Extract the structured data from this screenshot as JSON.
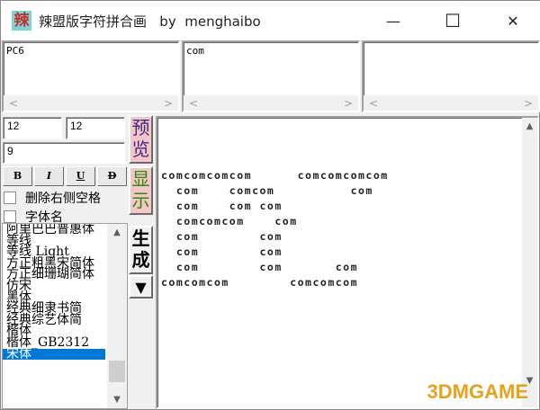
{
  "window": {
    "icon_char": "辣",
    "title": "辣盟版字符拼合画   by  menghaibo",
    "minimize": "—",
    "maximize": "☐",
    "close": "✕"
  },
  "inputs": {
    "text1": "PC6",
    "text2": "com",
    "text3": "",
    "width": "12",
    "height": "12",
    "size": "9"
  },
  "style_buttons": [
    "B",
    "I",
    "U",
    "D"
  ],
  "checkboxes": [
    "删除右侧空格",
    "字体名"
  ],
  "buttons": {
    "preview": "预览",
    "show": "显示",
    "generate": "生成",
    "dropdown": "▼"
  },
  "fonts": [
    "阿里巴巴普惠体",
    "等线",
    "等线 Light",
    "方正粗黑宋简体",
    "方正细珊瑚简体",
    "仿宋",
    "黑体",
    "经典细隶书简",
    "经典综艺体简",
    "楷体",
    "楷体_GB2312",
    "宋体"
  ],
  "selected_font": "宋体",
  "output_lines": [
    "comcomcomcom      comcomcomcom",
    "  com    comcom          com",
    "  com    com com",
    "  comcomcom    com",
    "  com        com",
    "  com        com",
    "  com        com       com",
    "comcomcom        comcomcom"
  ],
  "watermark": "3DMGAME"
}
